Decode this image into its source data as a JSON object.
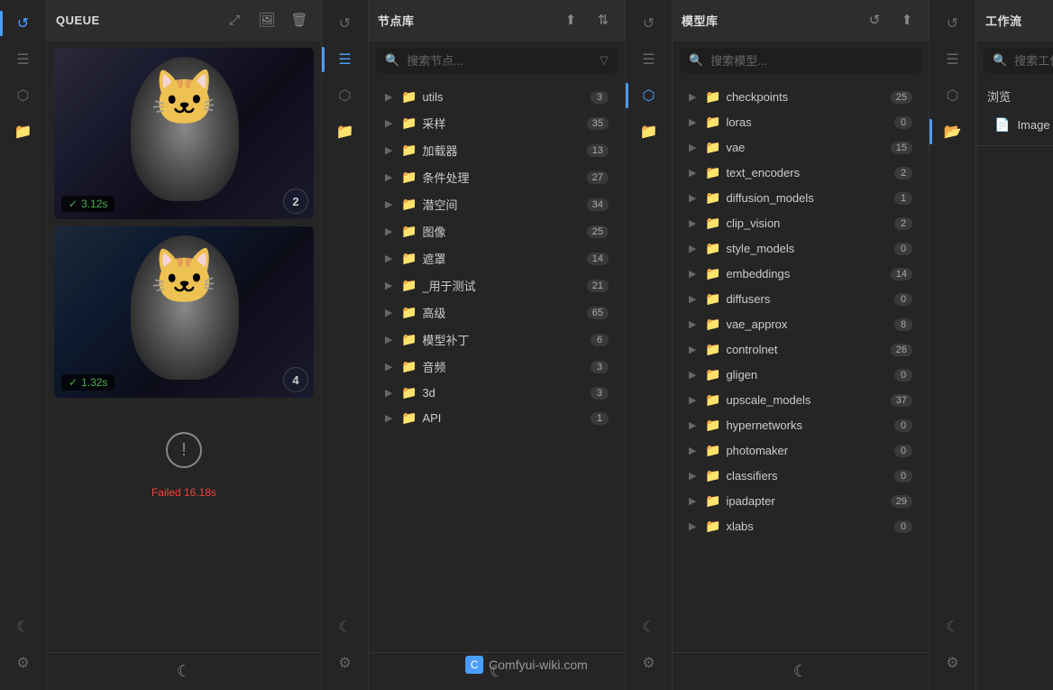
{
  "queue": {
    "title": "QUEUE",
    "items": [
      {
        "time": "3.12s",
        "badge": "2",
        "status": "success"
      },
      {
        "time": "1.32s",
        "badge": "4",
        "status": "success"
      }
    ],
    "failed": {
      "time": "16.18s",
      "label": "Failed 16.18s"
    }
  },
  "nodeLibrary": {
    "title": "节点库",
    "search_placeholder": "搜索节点...",
    "items": [
      {
        "label": "utils",
        "count": "3"
      },
      {
        "label": "采样",
        "count": "35"
      },
      {
        "label": "加载器",
        "count": "13"
      },
      {
        "label": "条件处理",
        "count": "27"
      },
      {
        "label": "潜空间",
        "count": "34"
      },
      {
        "label": "图像",
        "count": "25"
      },
      {
        "label": "遮罩",
        "count": "14"
      },
      {
        "label": "_用于测试",
        "count": "21"
      },
      {
        "label": "高级",
        "count": "65"
      },
      {
        "label": "模型补丁",
        "count": "6"
      },
      {
        "label": "音频",
        "count": "3"
      },
      {
        "label": "3d",
        "count": "3"
      },
      {
        "label": "API",
        "count": "1"
      }
    ]
  },
  "modelLibrary": {
    "title": "模型库",
    "search_placeholder": "搜索模型...",
    "items": [
      {
        "label": "checkpoints",
        "count": "25"
      },
      {
        "label": "loras",
        "count": "0"
      },
      {
        "label": "vae",
        "count": "15"
      },
      {
        "label": "text_encoders",
        "count": "2"
      },
      {
        "label": "diffusion_models",
        "count": "1"
      },
      {
        "label": "clip_vision",
        "count": "2"
      },
      {
        "label": "style_models",
        "count": "0"
      },
      {
        "label": "embeddings",
        "count": "14"
      },
      {
        "label": "diffusers",
        "count": "0"
      },
      {
        "label": "vae_approx",
        "count": "8"
      },
      {
        "label": "controlnet",
        "count": "26"
      },
      {
        "label": "gligen",
        "count": "0"
      },
      {
        "label": "upscale_models",
        "count": "37"
      },
      {
        "label": "hypernetworks",
        "count": "0"
      },
      {
        "label": "photomaker",
        "count": "0"
      },
      {
        "label": "classifiers",
        "count": "0"
      },
      {
        "label": "ipadapter",
        "count": "29"
      },
      {
        "label": "xlabs",
        "count": "0"
      }
    ]
  },
  "workflow": {
    "title": "工作流",
    "search_placeholder": "搜索工作流...",
    "browse_label": "浏览",
    "file": {
      "name": "Image to Image.json"
    }
  },
  "watermark": "Comfyui-wiki.com"
}
